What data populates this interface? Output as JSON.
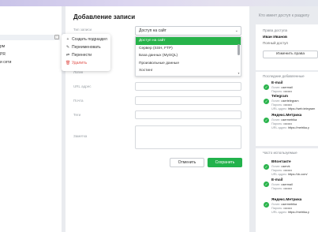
{
  "sidebar": {
    "rows": [
      "рм",
      "PR",
      "и сети"
    ],
    "scroll_glyph": "⋮"
  },
  "context_menu": {
    "items": [
      {
        "icon": "+",
        "label": "Создать подраздел"
      },
      {
        "icon": "✎",
        "label": "Переименовать"
      },
      {
        "icon": "⇄",
        "label": "Перенести"
      },
      {
        "icon": "🗑",
        "label": "Удалить"
      }
    ]
  },
  "form": {
    "title": "Добавление записи",
    "labels": {
      "type": "Тип записи",
      "login": "Логин",
      "url": "URL адрес",
      "mail": "Почта",
      "tags": "Теги",
      "notes": "Заметка"
    },
    "type_select": {
      "value": "Доступ на сайт",
      "chevron": "⌄"
    },
    "dropdown": {
      "options": [
        "Доступ на сайт",
        "Сервер (SSH, FTP)",
        "База данных (MySQL)",
        "Произвольные данные",
        "Хостинг"
      ],
      "selected_index": 0,
      "arrow_up": "▲",
      "arrow_down": "▼"
    },
    "cancel_label": "Отменить",
    "save_label": "Сохранить",
    "accent_color": "#22b24c"
  },
  "right_panel": {
    "heading": "Кто имеет доступ к разделу",
    "access": {
      "title": "Права доступа",
      "user_name": "Иван Иванов",
      "user_role": "Полный доступ",
      "change_button": "Изменить права"
    },
    "recent_title": "Последние добавленные",
    "recent": [
      {
        "title": "E-mail",
        "lines": [
          {
            "k": "Логин:",
            "v": "usermail"
          },
          {
            "k": "Пароль:",
            "v": "••••••••"
          }
        ]
      },
      {
        "title": "Telegram",
        "lines": [
          {
            "k": "Логин:",
            "v": "usertelegram"
          },
          {
            "k": "Пароль:",
            "v": "••••••••"
          },
          {
            "k": "URL адрес:",
            "v": "https://web.telegram"
          }
        ]
      },
      {
        "title": "Яндекс.Метрика",
        "lines": [
          {
            "k": "Логин:",
            "v": "usermetrika"
          },
          {
            "k": "Пароль:",
            "v": "••••••••"
          },
          {
            "k": "URL адрес:",
            "v": "https://metrika.y"
          }
        ]
      }
    ],
    "frequent_title": "Часто используемые",
    "frequent": [
      {
        "title": "ВКонтакте",
        "lines": [
          {
            "k": "Логин:",
            "v": "uservk"
          },
          {
            "k": "Пароль:",
            "v": "••••••••"
          },
          {
            "k": "URL адрес:",
            "v": "https://vk.com/"
          }
        ]
      },
      {
        "title": "E-mail",
        "lines": [
          {
            "k": "Логин:",
            "v": "usermail"
          },
          {
            "k": "Пароль:",
            "v": "••••••••"
          }
        ]
      },
      {
        "title": "Яндекс.Метрика",
        "lines": [
          {
            "k": "Логин:",
            "v": "usermetrika"
          },
          {
            "k": "Пароль:",
            "v": "••••••••"
          },
          {
            "k": "URL адрес:",
            "v": "https://metrika.y"
          }
        ]
      }
    ],
    "check_glyph": "✓"
  }
}
